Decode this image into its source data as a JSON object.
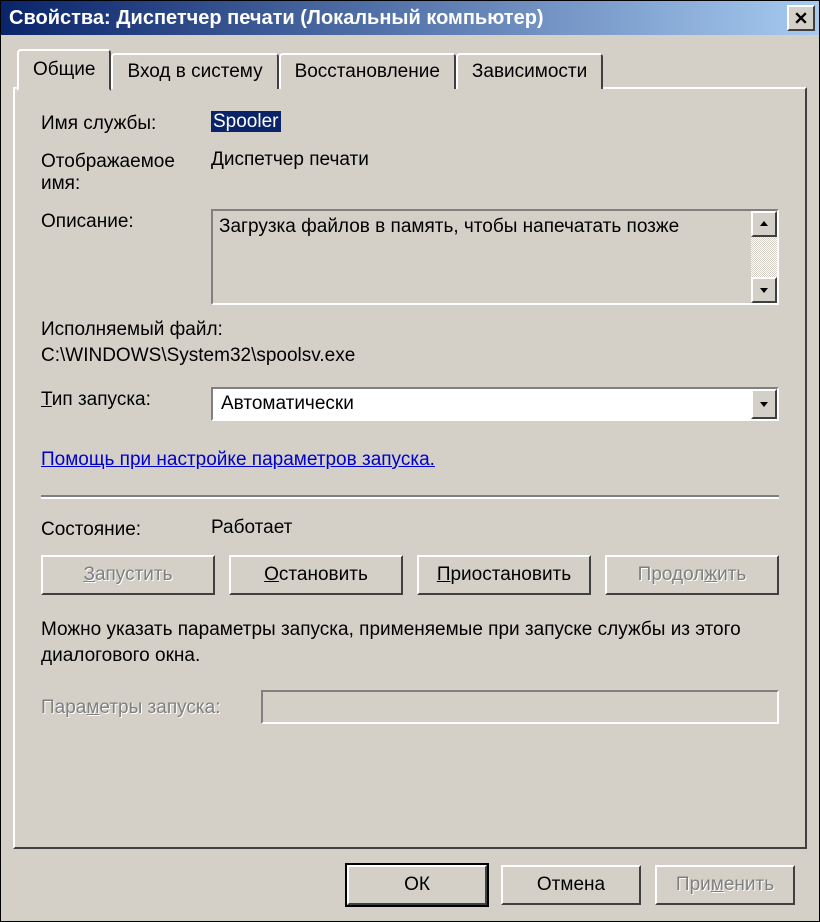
{
  "window": {
    "title": "Свойства: Диспетчер печати (Локальный компьютер)"
  },
  "tabs": {
    "general": "Общие",
    "logon": "Вход в систему",
    "recovery": "Восстановление",
    "dependencies": "Зависимости"
  },
  "general": {
    "service_name_label": "Имя службы:",
    "service_name_value": "Spooler",
    "display_name_label": "Отображаемое имя:",
    "display_name_value": "Диспетчер печати",
    "description_label": "Описание:",
    "description_value": "Загрузка файлов в память, чтобы напечатать позже",
    "exe_label": "Исполняемый файл:",
    "exe_value": "C:\\WINDOWS\\System32\\spoolsv.exe",
    "startup_type_label_pre": "",
    "startup_type_label_u": "Т",
    "startup_type_label_post": "ип запуска:",
    "startup_type_value": "Автоматически",
    "help_link": "Помощь при настройке параметров запуска.",
    "status_label": "Состояние:",
    "status_value": "Работает",
    "start_btn_u": "З",
    "start_btn_post": "апустить",
    "stop_btn_u": "О",
    "stop_btn_post": "становить",
    "pause_btn_u": "П",
    "pause_btn_post": "риостановить",
    "resume_btn": "Продол",
    "resume_btn_u": "ж",
    "resume_btn_post": "ить",
    "hint": "Можно указать параметры запуска, применяемые при запуске службы из этого диалогового окна.",
    "params_label_pre": "Пара",
    "params_label_u": "м",
    "params_label_post": "етры запуска:"
  },
  "footer": {
    "ok": "ОК",
    "cancel": "Отмена",
    "apply_pre": "При",
    "apply_u": "м",
    "apply_post": "енить"
  }
}
